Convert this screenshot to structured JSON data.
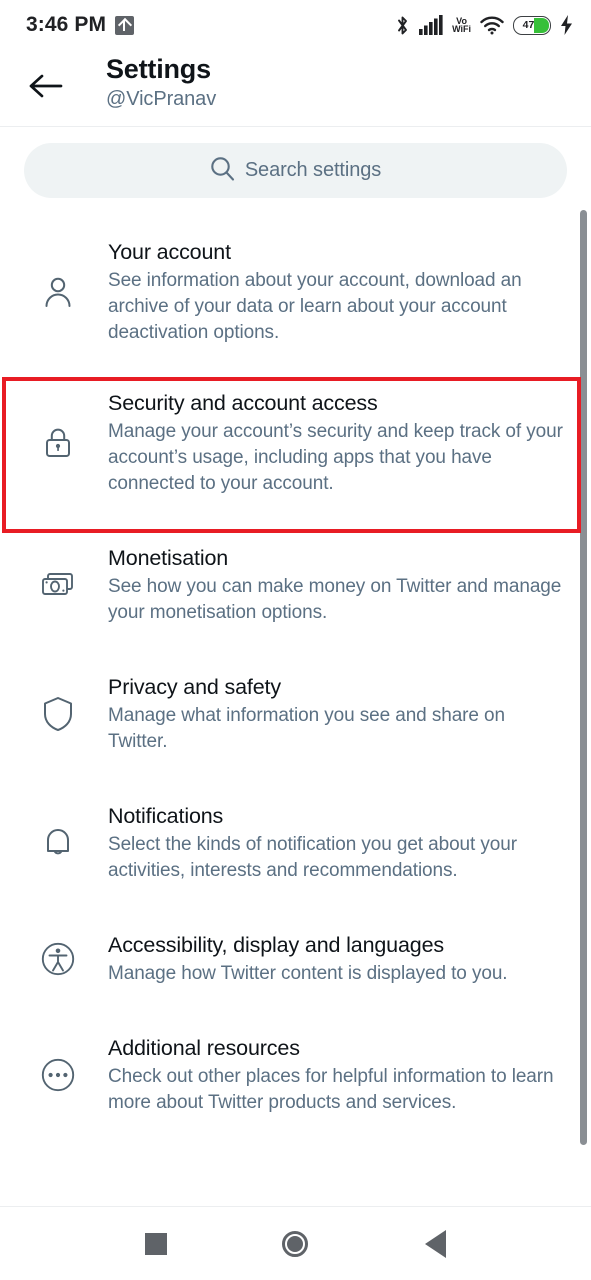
{
  "status_bar": {
    "time": "3:46 PM",
    "upload_icon": "upload-indicator-icon",
    "bluetooth_icon": "bluetooth-icon",
    "signal_icon": "cellular-signal-icon",
    "volte_line1": "Vo",
    "volte_line2": "WiFi",
    "wifi_icon": "wifi-icon",
    "battery_percent": "47",
    "battery_fill_color": "#37c039",
    "charging_icon": "charging-bolt-icon"
  },
  "header": {
    "back_icon": "back-arrow-icon",
    "title": "Settings",
    "subtitle": "@VicPranav"
  },
  "search": {
    "icon": "search-icon",
    "placeholder": "Search settings",
    "value": ""
  },
  "settings": {
    "items": [
      {
        "icon": "person-icon",
        "title": "Your account",
        "description": "See information about your account, download an archive of your data or learn about your account deactivation options."
      },
      {
        "icon": "lock-icon",
        "title": "Security and account access",
        "description": "Manage your account’s security and keep track of your account’s usage, including apps that you have connected to your account."
      },
      {
        "icon": "money-icon",
        "title": "Monetisation",
        "description": "See how you can make money on Twitter and manage your monetisation options."
      },
      {
        "icon": "shield-icon",
        "title": "Privacy and safety",
        "description": "Manage what information you see and share on Twitter."
      },
      {
        "icon": "bell-icon",
        "title": "Notifications",
        "description": "Select the kinds of notification you get about your activities, interests and recommendations."
      },
      {
        "icon": "accessibility-icon",
        "title": "Accessibility, display and languages",
        "description": "Manage how Twitter content is displayed to you."
      },
      {
        "icon": "ellipsis-circle-icon",
        "title": "Additional resources",
        "description": "Check out other places for helpful information to learn more about Twitter products and services."
      }
    ]
  },
  "highlight": {
    "target": "Security and account access",
    "color": "#e81c24"
  },
  "nav_bar": {
    "recents_icon": "square-recents-icon",
    "home_icon": "circle-home-icon",
    "back_icon": "triangle-back-icon"
  }
}
